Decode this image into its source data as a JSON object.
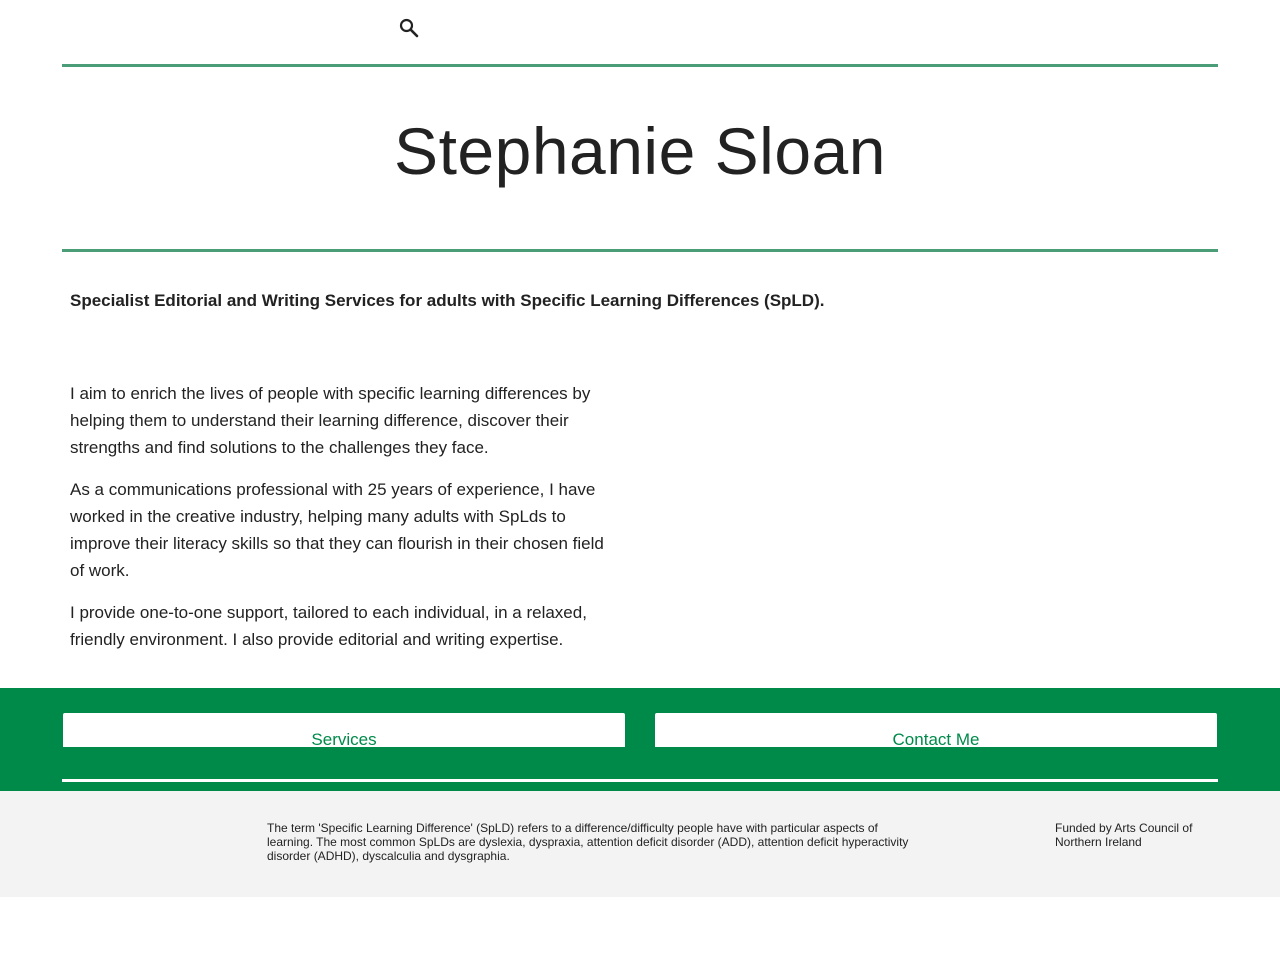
{
  "header": {
    "search_icon": "search-icon",
    "site_title": "Stephanie Sloan"
  },
  "main": {
    "intro": "Specialist Editorial and Writing Services for adults with Specific Learning Differences (SpLD).",
    "paragraphs": [
      "I aim to enrich the lives of people with specific learning differences by helping them to understand their learning difference, discover their strengths and find solutions to the challenges they face.",
      "As a communications professional with 25 years of experience, I have worked in the creative industry, helping many adults with SpLds to improve their  literacy skills so that they can flourish in their chosen field of work.",
      "I provide one-to-one support, tailored to each individual, in a relaxed, friendly environment. I also provide editorial and writing expertise."
    ]
  },
  "cta": {
    "services_label": "Services",
    "contact_label": "Contact Me"
  },
  "footer": {
    "note": "The term 'Specific Learning Difference' (SpLD) refers to a difference/difficulty people have with particular aspects of learning. The most common SpLDs are dyslexia, dyspraxia, attention deficit disorder (ADD), attention deficit hyperactivity disorder (ADHD), dyscalculia and dysgraphia.",
    "funded": "Funded by Arts Council of Northern Ireland"
  },
  "colors": {
    "accent_green": "#008a4a",
    "rule_green": "#4a9d77",
    "footer_bg": "#f3f3f3",
    "text": "#222222"
  }
}
